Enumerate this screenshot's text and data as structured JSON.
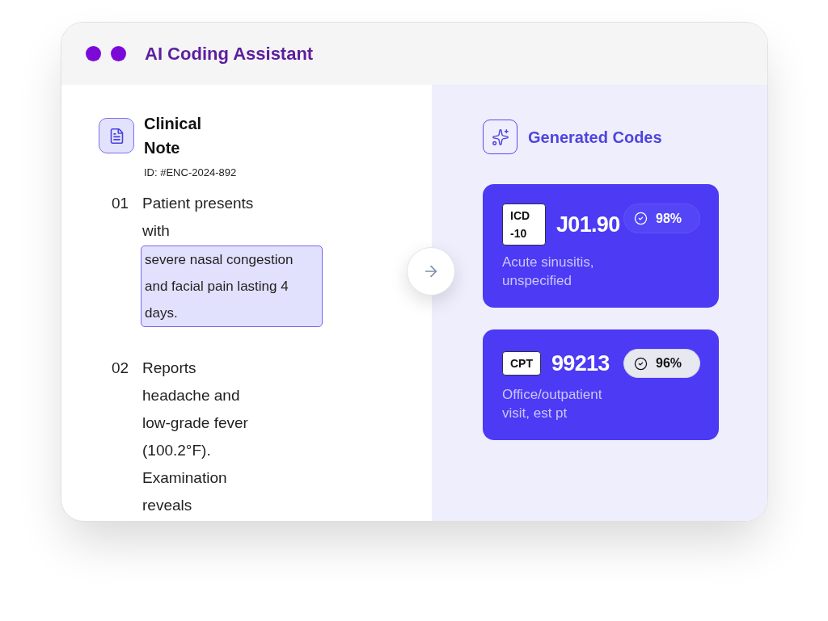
{
  "window": {
    "title": "AI Coding Assistant"
  },
  "clinical_note": {
    "title": "Clinical Note",
    "id": "ID: #ENC-2024-892",
    "items": [
      {
        "number": "01",
        "text": "Patient presents with",
        "highlight": "severe nasal congestion and facial pain lasting 4 days."
      },
      {
        "number": "02",
        "text": "Reports headache and low-grade fever (100.2°F). Examination reveals"
      }
    ]
  },
  "generated_codes": {
    "title": "Generated Codes",
    "codes": [
      {
        "system": "ICD -10",
        "code": "J01.90",
        "confidence": "98%",
        "highlighted": false,
        "description": "Acute sinusitis, unspecified"
      },
      {
        "system": "CPT",
        "code": "99213",
        "confidence": "96%",
        "highlighted": true,
        "description": "Office/outpatient visit, est pt"
      }
    ]
  }
}
